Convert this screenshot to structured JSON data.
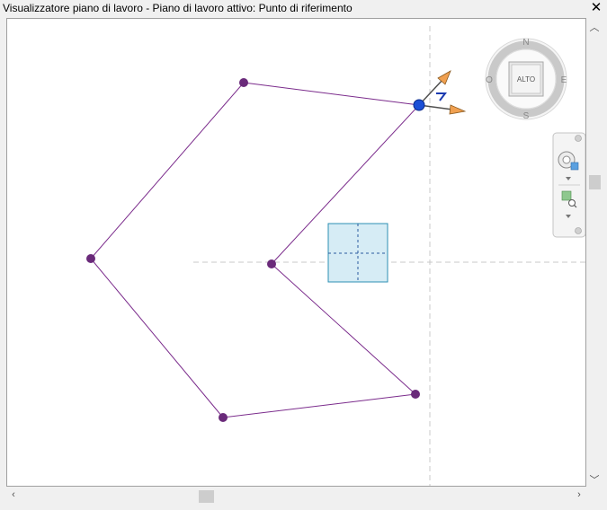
{
  "window": {
    "title": "Visualizzatore piano di lavoro - Piano di lavoro attivo: Punto di riferimento",
    "close_icon": "close-icon"
  },
  "viewcube": {
    "face_label": "ALTO",
    "compass": {
      "north": "N",
      "south": "S",
      "east": "E",
      "west": "O"
    }
  },
  "navigation_bar": {
    "items": [
      "full-navigation-wheel-icon",
      "zoom-region-icon"
    ]
  },
  "scrollbars": {
    "vertical": {
      "up_icon": "chevron-up-icon",
      "down_icon": "chevron-down-icon"
    },
    "horizontal": {
      "left_icon": "chevron-left-icon",
      "right_icon": "chevron-right-icon"
    }
  },
  "colors": {
    "sketch_line": "#7b2c8c",
    "vertex": "#6a2a7a",
    "active_point": "#1b4fd6",
    "workplane_fill": "#d6ecf5",
    "workplane_border": "#2c8fb3",
    "axis_arrow": "#f0a050"
  }
}
